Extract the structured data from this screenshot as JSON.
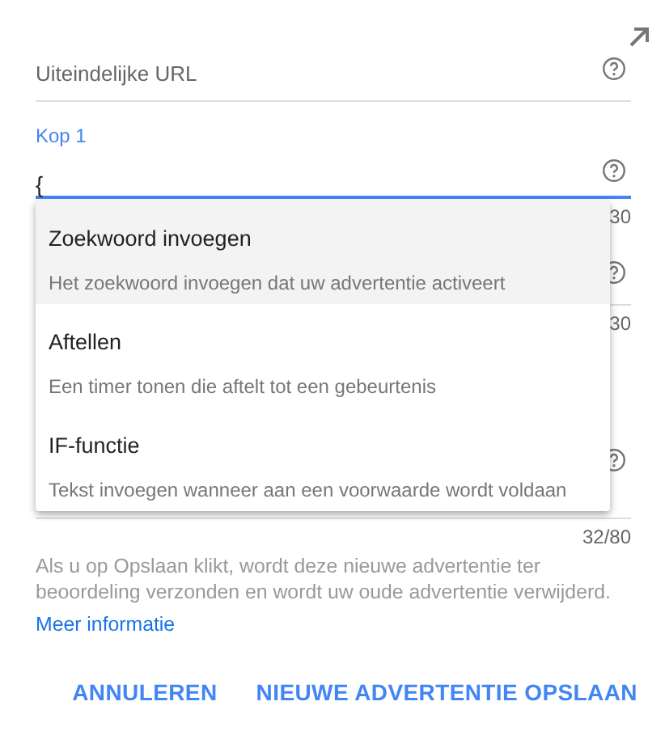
{
  "fields": [
    {
      "label": "Uiteindelijke URL",
      "focused": false
    },
    {
      "label": "Kop 1",
      "value": "{",
      "focused": true,
      "counter": "30"
    },
    {
      "focused": false,
      "counter": "30"
    },
    {
      "focused": false,
      "counter": "32/80"
    }
  ],
  "menu": [
    {
      "title": "Zoekwoord invoegen",
      "description": "Het zoekwoord invoegen dat uw advertentie activeert",
      "selected": true
    },
    {
      "title": "Aftellen",
      "description": "Een timer tonen die aftelt tot een gebeurtenis",
      "selected": false
    },
    {
      "title": "IF-functie",
      "description": "Tekst invoegen wanneer aan een voorwaarde wordt voldaan",
      "selected": false
    }
  ],
  "notice": "Als u op Opslaan klikt, wordt deze nieuwe advertentie ter beoordeling verzonden en wordt uw oude advertentie verwijderd.",
  "link": "Meer informatie",
  "buttons": [
    "ANNULEREN",
    "NIEUWE ADVERTENTIE OPSLAAN"
  ]
}
